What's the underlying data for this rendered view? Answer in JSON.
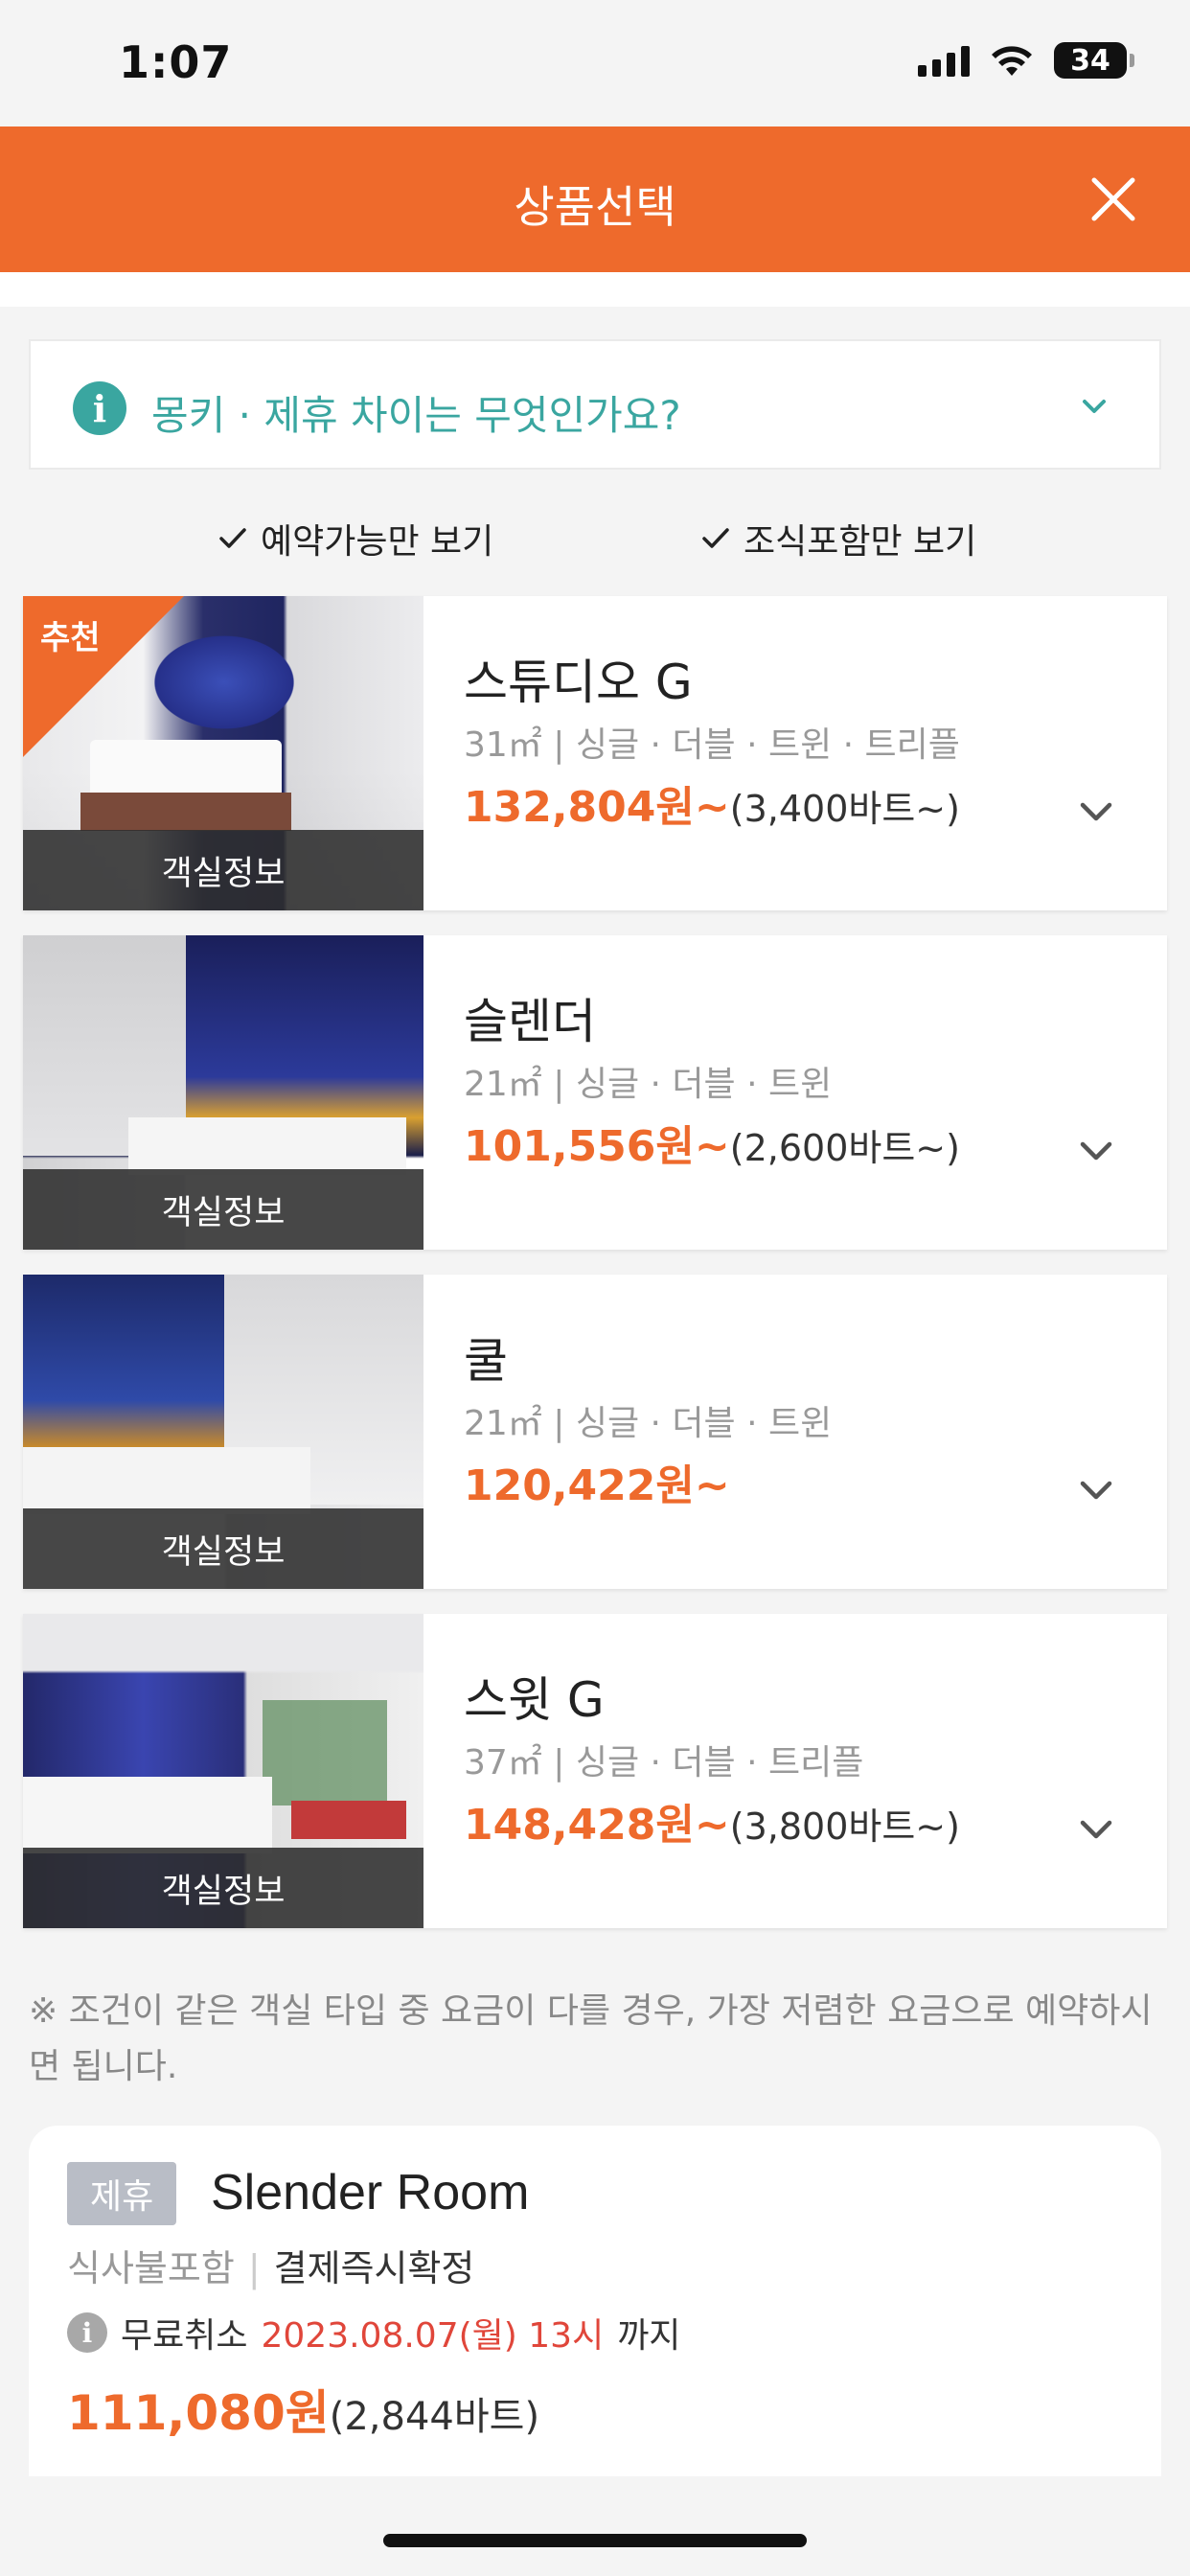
{
  "status": {
    "time": "1:07",
    "battery": "34"
  },
  "header": {
    "title": "상품선택"
  },
  "info": {
    "question": "몽키 · 제휴 차이는 무엇인가요?"
  },
  "filters": {
    "available": "예약가능만 보기",
    "breakfast": "조식포함만 보기"
  },
  "rooms": [
    {
      "badge": "추천",
      "image_label": "객실정보",
      "name": "스튜디오 G",
      "spec": "31㎡ | 싱글 · 더블 · 트윈 · 트리플",
      "price": "132,804원~",
      "baht": "(3,400바트~)"
    },
    {
      "image_label": "객실정보",
      "name": "슬렌더",
      "spec": "21㎡ | 싱글 · 더블 · 트윈",
      "price": "101,556원~",
      "baht": "(2,600바트~)"
    },
    {
      "image_label": "객실정보",
      "name": "쿨",
      "spec": "21㎡ | 싱글 · 더블 · 트윈",
      "price": "120,422원~",
      "baht": ""
    },
    {
      "image_label": "객실정보",
      "name": "스윗 G",
      "spec": "37㎡ | 싱글 · 더블 · 트리플",
      "price": "148,428원~",
      "baht": "(3,800바트~)"
    }
  ],
  "notice": "※ 조건이 같은 객실 타입 중 요금이 다를 경우, 가장 저렴한 요금으로 예약하시면 됩니다.",
  "offer": {
    "tag": "제휴",
    "title": "Slender Room",
    "meal": "식사불포함",
    "confirm": "결제즉시확정",
    "cancel_label": "무료취소",
    "cancel_date": "2023.08.07(월) 13시",
    "cancel_suffix": "까지",
    "price": "111,080원",
    "baht": "(2,844바트)"
  },
  "colors": {
    "accent": "#ee6a2c",
    "teal": "#3aa6a0",
    "red": "#e0463a"
  }
}
